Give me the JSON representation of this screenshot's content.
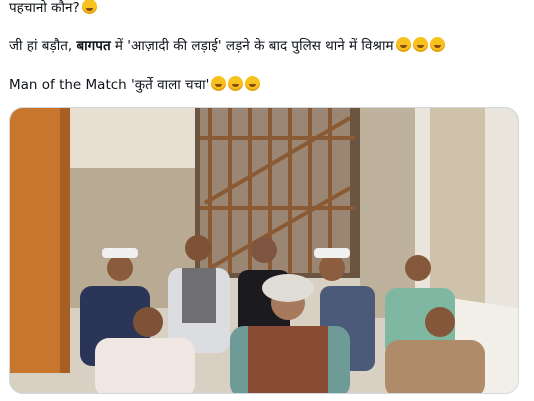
{
  "tweet": {
    "line1_text": "पहचानो कौन?",
    "line2_prefix": "जी हां बड़ौत, ",
    "line2_bold": "बागपत",
    "line2_suffix": " में 'आज़ादी की लड़ाई' लड़ने के बाद पुलिस थाने में विश्राम",
    "line3_text": "Man of the Match 'कुर्ते वाला चचा'",
    "emoji_names": [
      "smiling-face-icon",
      "rolling-laughing-icon"
    ]
  },
  "media": {
    "description_icon": "photo"
  }
}
